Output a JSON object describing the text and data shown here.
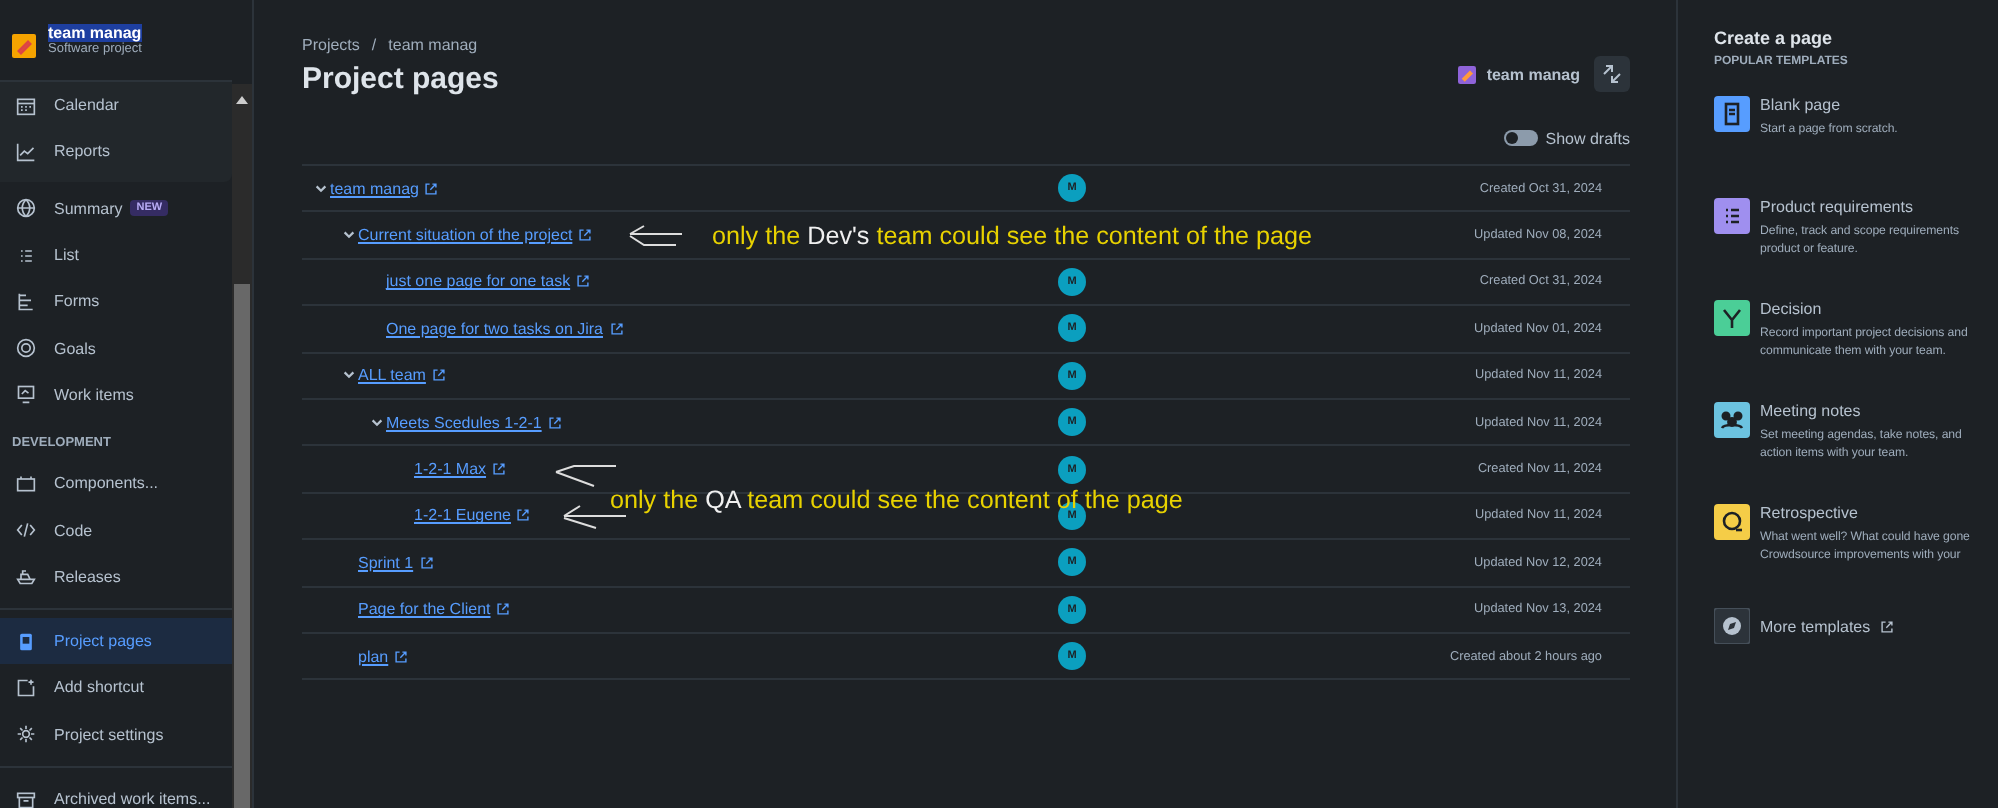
{
  "sidebar": {
    "project": {
      "name": "team manag",
      "type": "Software project",
      "name_selected": true
    },
    "card_items": [
      {
        "label": "Calendar",
        "selected": false
      },
      {
        "label": "Reports",
        "selected": false
      }
    ],
    "sections": [
      {
        "items": [
          {
            "label": "Summary",
            "badge": "NEW",
            "selected": false
          },
          {
            "label": "List",
            "selected": false
          },
          {
            "label": "Forms",
            "selected": false
          },
          {
            "label": "Goals",
            "selected": false
          },
          {
            "label": "Work items",
            "selected": false
          }
        ]
      },
      {
        "heading": "DEVELOPMENT",
        "items": [
          {
            "label": "Components...",
            "selected": false
          },
          {
            "label": "Code",
            "selected": false
          },
          {
            "label": "Releases",
            "selected": false
          }
        ]
      },
      {
        "items": [
          {
            "label": "Project pages",
            "selected": true
          },
          {
            "label": "Add shortcut",
            "selected": false
          },
          {
            "label": "Project settings",
            "selected": false
          }
        ]
      },
      {
        "items": [
          {
            "label": "Archived work items...",
            "selected": false
          }
        ]
      }
    ]
  },
  "breadcrumb": [
    "Projects",
    "team manag"
  ],
  "breadcrumb_separator": "/",
  "title": "Project pages",
  "space_chip": "team manag",
  "show_drafts": {
    "label": "Show drafts",
    "on": false
  },
  "pages": [
    {
      "title": "team manag",
      "avatar": "M",
      "date": "Created Oct 31, 2024",
      "expanded": true,
      "children": [
        {
          "title": "Current situation of the project",
          "date": "Updated Nov 08, 2024",
          "expanded": true,
          "children": [
            {
              "title": "just one page for one task",
              "avatar": "M",
              "date": "Created Oct 31, 2024"
            },
            {
              "title": "One page for two tasks on Jira",
              "avatar": "M",
              "date": "Updated Nov 01, 2024"
            }
          ]
        },
        {
          "title": "ALL team",
          "avatar": "M",
          "date": "Updated Nov 11, 2024",
          "expanded": true,
          "children": [
            {
              "title": "Meets Scedules 1-2-1",
              "avatar": "M",
              "date": "Updated Nov 11, 2024",
              "expanded": true,
              "children": [
                {
                  "title": "1-2-1 Max",
                  "avatar": "M",
                  "date": "Created Nov 11, 2024"
                },
                {
                  "title": "1-2-1 Eugene",
                  "avatar": "M",
                  "date": "Updated Nov 11, 2024"
                }
              ]
            }
          ]
        },
        {
          "title": "Sprint 1",
          "avatar": "M",
          "date": "Updated Nov 12, 2024"
        },
        {
          "title": "Page for the Client",
          "avatar": "M",
          "date": "Updated Nov 13, 2024"
        },
        {
          "title": "plan",
          "avatar": "M",
          "date": "Created about 2 hours ago"
        }
      ]
    }
  ],
  "annotations": [
    {
      "before": "only the ",
      "emphasis": "Dev's",
      "after": " team could see the content of the page"
    },
    {
      "before": "only the ",
      "emphasis": "QA",
      "after": " team could see the content of the page"
    }
  ],
  "create_panel": {
    "title": "Create a page",
    "subtitle": "POPULAR TEMPLATES",
    "templates": [
      {
        "name": "Blank page",
        "color": "#579dff",
        "description": [
          "Start a page from scratch."
        ]
      },
      {
        "name": "Product requirements",
        "color": "#9f8fef",
        "description": [
          "Define, track and scope requirements",
          "product or feature."
        ]
      },
      {
        "name": "Decision",
        "color": "#4bce97",
        "description": [
          "Record important project decisions and",
          "communicate them with your team."
        ]
      },
      {
        "name": "Meeting notes",
        "color": "#6cc3e0",
        "description": [
          "Set meeting agendas, take notes, and",
          "action items with your team."
        ]
      },
      {
        "name": "Retrospective",
        "color": "#f5cd47",
        "description": [
          "What went well? What could have gone",
          "Crowdsource improvements with your"
        ]
      }
    ],
    "more": "More templates"
  }
}
